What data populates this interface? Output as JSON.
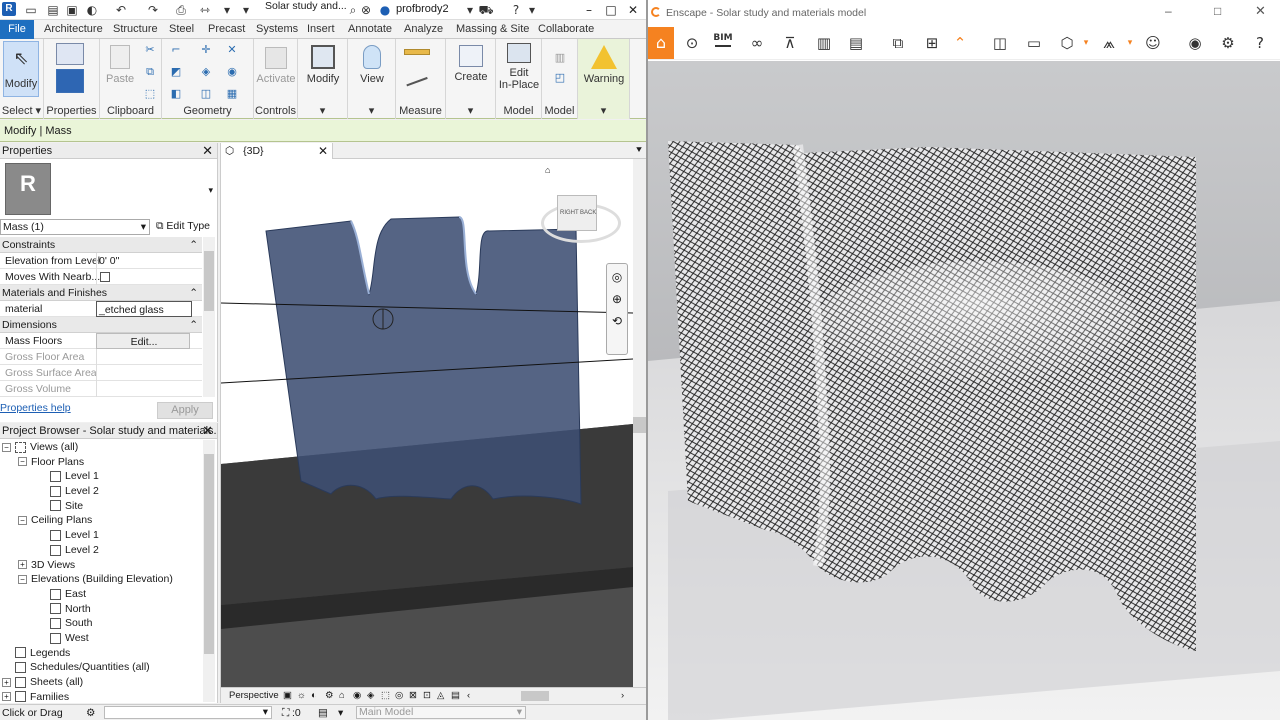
{
  "revit": {
    "title_file": "Solar study and...",
    "user": "profbrody2",
    "tabs": [
      "File",
      "Architecture",
      "Structure",
      "Steel",
      "Precast",
      "Systems",
      "Insert",
      "Annotate",
      "Analyze",
      "Massing & Site",
      "Collaborate"
    ],
    "ribbon": {
      "modify_label": "Modify",
      "select_label": "Select",
      "properties_label": "Properties",
      "paste_label": "Paste",
      "clipboard_label": "Clipboard",
      "geometry_label": "Geometry",
      "activate_label": "Activate",
      "controls_label": "Controls",
      "modify2_label": "Modify",
      "view_label": "View",
      "measure_label": "Measure",
      "create_label": "Create",
      "edit_inplace_line1": "Edit",
      "edit_inplace_line2": "In-Place",
      "model_label": "Model",
      "model2_label": "Model",
      "warning_label": "Warning"
    },
    "context_bar": "Modify | Mass",
    "properties": {
      "title": "Properties",
      "type_selector": "Mass (1)",
      "edit_type": "Edit Type",
      "sections": {
        "constraints": "Constraints",
        "materials": "Materials and Finishes",
        "dimensions": "Dimensions"
      },
      "rows": {
        "elevation_key": "Elevation from Level",
        "elevation_val": "0'  0\"",
        "moves_key": "Moves With Nearb...",
        "material_key": "material",
        "material_val": "_etched glass",
        "mass_floors_key": "Mass Floors",
        "mass_floors_val": "Edit...",
        "gfa_key": "Gross Floor Area",
        "gsa_key": "Gross Surface Area",
        "gv_key": "Gross Volume"
      },
      "help_link": "Properties help",
      "apply": "Apply"
    },
    "view_tab": "{3D}",
    "viewcube": {
      "right": "RIGHT",
      "back": "BACK"
    },
    "view_bar": {
      "mode": "Perspective"
    },
    "browser": {
      "title": "Project Browser - Solar study and materials...",
      "views_all": "Views (all)",
      "floor_plans": "Floor Plans",
      "fp_items": [
        "Level 1",
        "Level 2",
        "Site"
      ],
      "ceiling_plans": "Ceiling Plans",
      "cp_items": [
        "Level 1",
        "Level 2"
      ],
      "views3d": "3D Views",
      "elevations": "Elevations (Building Elevation)",
      "el_items": [
        "East",
        "North",
        "South",
        "West"
      ],
      "legends": "Legends",
      "schedules": "Schedules/Quantities (all)",
      "sheets": "Sheets (all)",
      "families": "Families"
    },
    "status": {
      "hint": "Click or Drag",
      "count": ":0",
      "model": "Main Model"
    }
  },
  "enscape": {
    "title": "Enscape - Solar study and materials model",
    "accent": "#f58220",
    "toolbar_icons": [
      "home-icon",
      "location-icon",
      "bim-icon",
      "binoculars-icon",
      "perspective-icon",
      "buildings-icon",
      "clapper-icon",
      "screenshot-icon",
      "batch-icon",
      "chevron-up-icon",
      "map-icon",
      "video-icon",
      "cube-icon",
      "asset-library-icon",
      "collaboration-icon",
      "eye-icon",
      "settings-icon"
    ],
    "bim_label": "BIM"
  }
}
